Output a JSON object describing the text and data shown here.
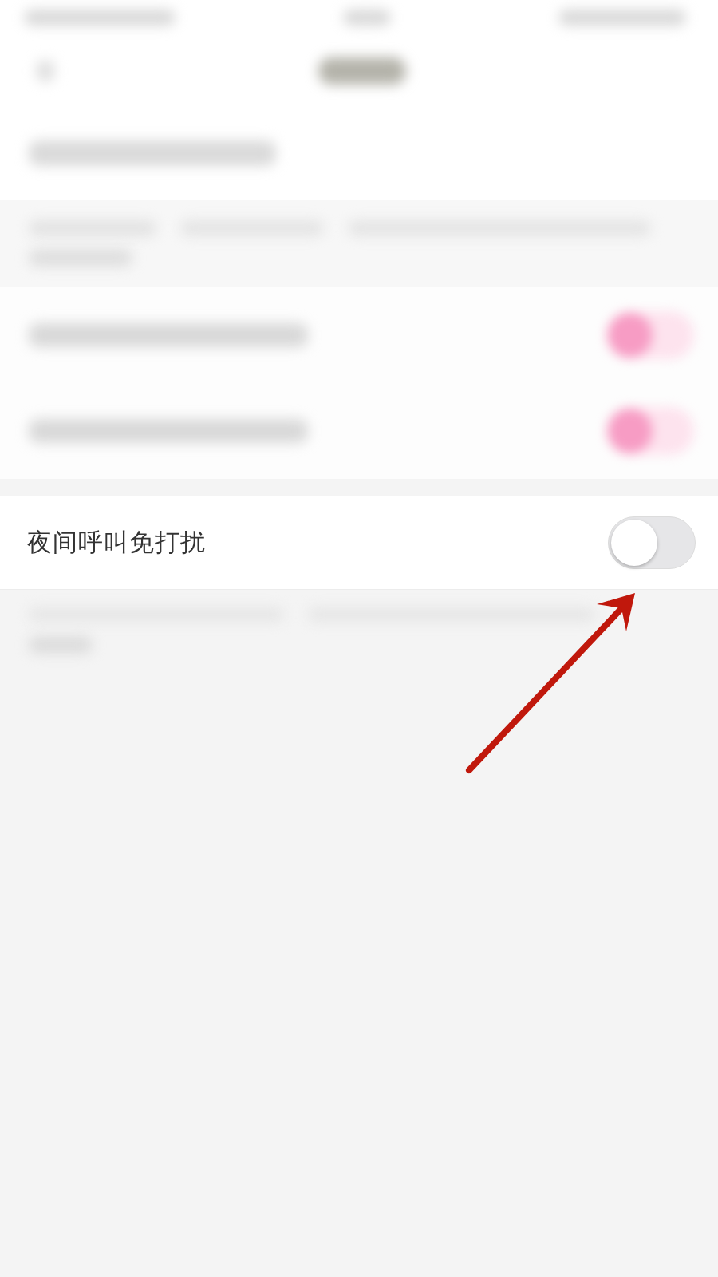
{
  "settings": [
    {
      "kind": "blurred",
      "on": true
    },
    {
      "kind": "blurred",
      "on": true
    },
    {
      "kind": "switch",
      "label": "夜间呼叫免打扰",
      "on": false
    }
  ]
}
